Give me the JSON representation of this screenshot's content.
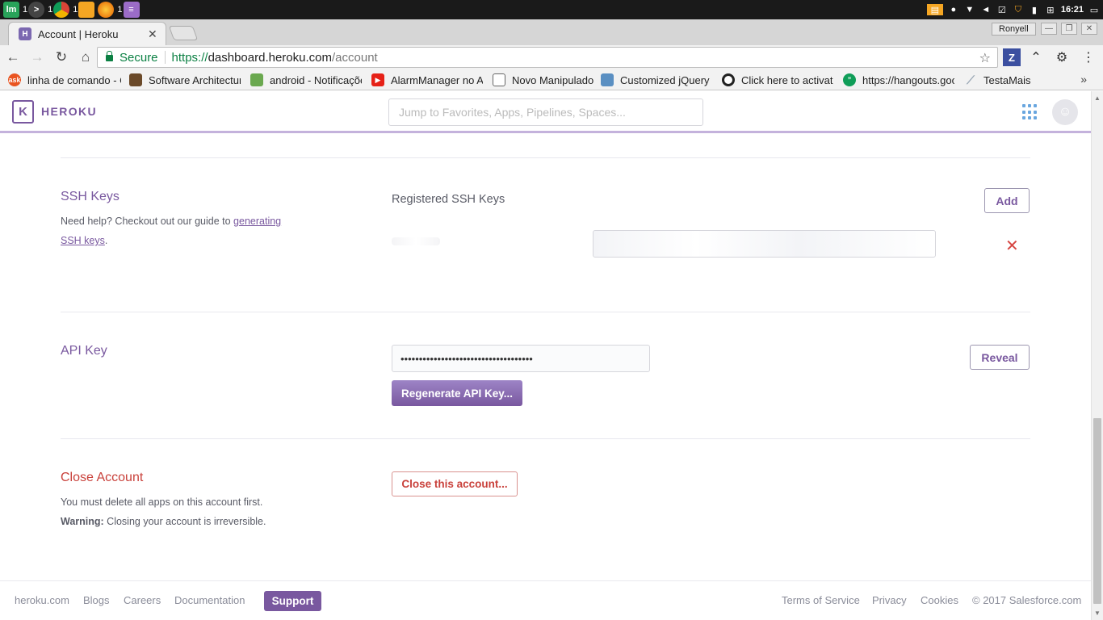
{
  "taskbar": {
    "apps": [
      {
        "name": "lm",
        "count": ""
      },
      {
        "name": "terminal",
        "count": "1"
      },
      {
        "name": "chrome",
        "count": "1"
      },
      {
        "name": "files",
        "count": "1"
      },
      {
        "name": "firefox",
        "count": ""
      },
      {
        "name": "notes",
        "count": "1"
      }
    ],
    "clock": "16:21"
  },
  "browser": {
    "tab_title": "Account | Heroku",
    "profile": "Ronyell",
    "secure_label": "Secure",
    "url_scheme": "https://",
    "url_host": "dashboard.heroku.com",
    "url_path": "/account"
  },
  "bookmarks": [
    {
      "label": "linha de comando - C",
      "color": "#e95420"
    },
    {
      "label": "Software Architectur",
      "color": "#6b4a2a"
    },
    {
      "label": "android - Notificaçõe",
      "color": "#6aa84f"
    },
    {
      "label": "AlarmManager no A",
      "color": "#e62117"
    },
    {
      "label": "Novo Manipulado",
      "color": "#ffffff"
    },
    {
      "label": "Customized jQuery U",
      "color": "#5a8fc2"
    },
    {
      "label": "Click here to activate",
      "color": "#222222"
    },
    {
      "label": "https://hangouts.goo",
      "color": "#0f9d58"
    },
    {
      "label": "TestaMais",
      "color": "#9aa7b5"
    }
  ],
  "header": {
    "logo_text": "HEROKU",
    "search_placeholder": "Jump to Favorites, Apps, Pipelines, Spaces..."
  },
  "ssh": {
    "title": "SSH Keys",
    "desc_prefix": "Need help? Checkout out our guide to ",
    "desc_link": "generating SSH keys",
    "desc_suffix": ".",
    "registered_title": "Registered SSH Keys",
    "add_label": "Add",
    "key_value": "",
    "remove_icon": "close-icon"
  },
  "api": {
    "title": "API Key",
    "key_value": "••••••••••••••••••••••••••••••••••••",
    "reveal_label": "Reveal",
    "regenerate_label": "Regenerate API Key..."
  },
  "close": {
    "title": "Close Account",
    "line1": "You must delete all apps on this account first.",
    "warning_label": "Warning:",
    "warning_text": " Closing your account is irreversible.",
    "button_label": "Close this account..."
  },
  "footer": {
    "left_links": [
      "heroku.com",
      "Blogs",
      "Careers",
      "Documentation"
    ],
    "support_label": "Support",
    "right_links": [
      "Terms of Service",
      "Privacy",
      "Cookies",
      "© 2017 Salesforce.com"
    ]
  },
  "colors": {
    "brand": "#79589f",
    "danger": "#c9413b",
    "secure": "#0b8043"
  }
}
